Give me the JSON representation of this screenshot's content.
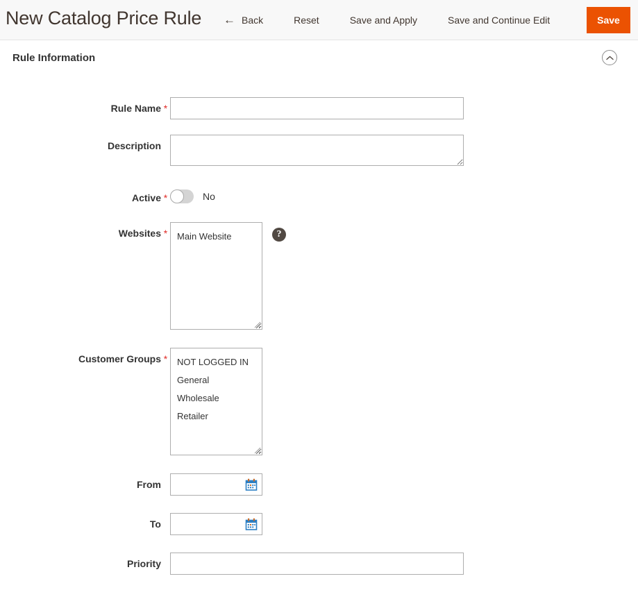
{
  "header": {
    "title": "New Catalog Price Rule",
    "back_label": "Back",
    "back_icon": "arrow-left-icon",
    "reset_label": "Reset",
    "save_and_apply_label": "Save and Apply",
    "save_and_continue_label": "Save and Continue Edit",
    "save_label": "Save",
    "save_button_color": "#eb5202"
  },
  "section": {
    "title": "Rule Information",
    "collapse_icon": "chevron-up-circle-icon"
  },
  "form": {
    "rule_name": {
      "label": "Rule Name",
      "required": "*",
      "value": "",
      "placeholder": ""
    },
    "description": {
      "label": "Description",
      "required": "",
      "value": "",
      "placeholder": ""
    },
    "active": {
      "label": "Active",
      "required": "*",
      "state_label": "No",
      "checked": false
    },
    "websites": {
      "label": "Websites",
      "required": "*",
      "options": [
        "Main Website"
      ],
      "help_icon": "question-mark-icon"
    },
    "customer_groups": {
      "label": "Customer Groups",
      "required": "*",
      "options": [
        "NOT LOGGED IN",
        "General",
        "Wholesale",
        "Retailer"
      ]
    },
    "from": {
      "label": "From",
      "required": "",
      "value": "",
      "placeholder": "",
      "calendar_icon": "calendar-icon"
    },
    "to": {
      "label": "To",
      "required": "",
      "value": "",
      "placeholder": "",
      "calendar_icon": "calendar-icon"
    },
    "priority": {
      "label": "Priority",
      "required": "",
      "value": "",
      "placeholder": ""
    }
  }
}
